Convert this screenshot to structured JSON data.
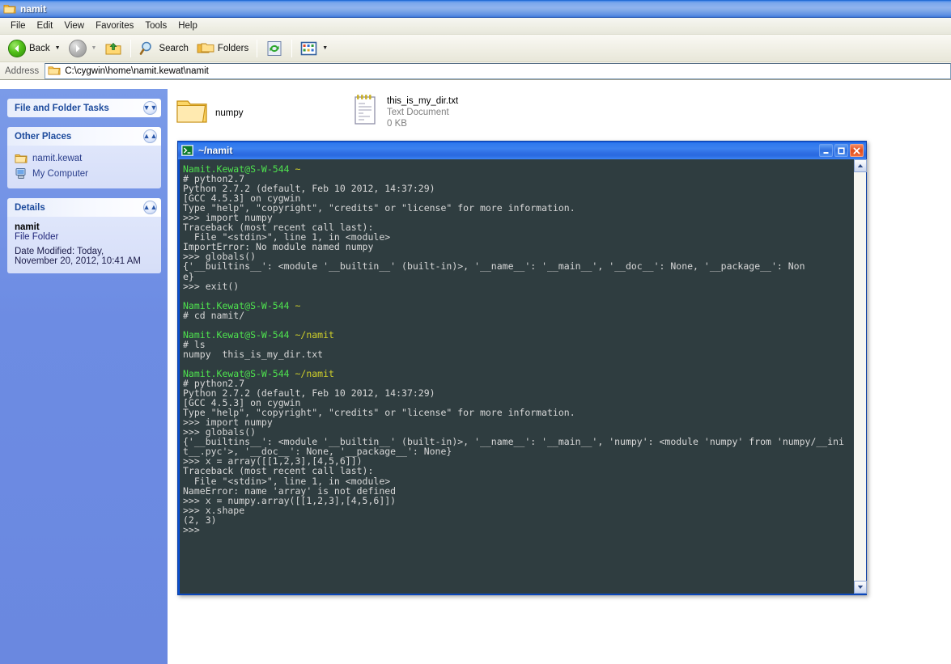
{
  "explorer": {
    "window_title": "namit",
    "window_icon": "folder-icon",
    "menu": [
      "File",
      "Edit",
      "View",
      "Favorites",
      "Tools",
      "Help"
    ],
    "toolbar": {
      "back_label": "Back",
      "back_icon": "back-arrow-icon",
      "forward_icon": "forward-arrow-icon",
      "up_icon": "up-folder-icon",
      "search_label": "Search",
      "search_icon": "search-icon",
      "folders_label": "Folders",
      "folders_icon": "folders-icon",
      "refresh_icon": "refresh-icon",
      "views_icon": "views-icon"
    },
    "address": {
      "label": "Address",
      "icon": "folder-icon",
      "value": "C:\\cygwin\\home\\namit.kewat\\namit",
      "placeholder": ""
    },
    "task_pane": {
      "groups": [
        {
          "title": "File and Folder Tasks",
          "chevron": "chevron-down-icon",
          "collapsed": true,
          "links": []
        },
        {
          "title": "Other Places",
          "chevron": "chevron-up-icon",
          "collapsed": false,
          "links": [
            {
              "label": "namit.kewat",
              "icon": "folder-icon"
            },
            {
              "label": "My Computer",
              "icon": "my-computer-icon"
            }
          ]
        },
        {
          "title": "Details",
          "chevron": "chevron-up-icon",
          "collapsed": false,
          "details": {
            "name": "namit",
            "type": "File Folder",
            "modified_line1": "Date Modified: Today,",
            "modified_line2": "November 20, 2012, 10:41 AM"
          }
        }
      ]
    },
    "files": [
      {
        "name": "numpy",
        "type": "",
        "size": "",
        "icon": "folder-icon"
      },
      {
        "name": "this_is_my_dir.txt",
        "type": "Text Document",
        "size": "0 KB",
        "icon": "text-document-icon"
      }
    ]
  },
  "terminal": {
    "window_title": "~/namit",
    "window_icon": "console-icon",
    "buttons": {
      "minimize": "_",
      "maximize": "□",
      "close": "✕"
    },
    "colors": {
      "background": "#2f3d40",
      "text": "#d8d8d8",
      "prompt_host": "#4ee24e",
      "prompt_path": "#cfcf2a",
      "titlebar": "#2a6ae0"
    },
    "scrollbar": {
      "up_icon": "chevron-up-icon",
      "down_icon": "chevron-down-icon"
    },
    "lines": [
      {
        "segments": [
          {
            "text": "Namit.Kewat@S-W-544 ",
            "color": "green"
          },
          {
            "text": "~",
            "color": "yellow"
          }
        ]
      },
      {
        "segments": [
          {
            "text": "# python2.7",
            "color": "white"
          }
        ]
      },
      {
        "segments": [
          {
            "text": "Python 2.7.2 (default, Feb 10 2012, 14:37:29)",
            "color": "white"
          }
        ]
      },
      {
        "segments": [
          {
            "text": "[GCC 4.5.3] on cygwin",
            "color": "white"
          }
        ]
      },
      {
        "segments": [
          {
            "text": "Type \"help\", \"copyright\", \"credits\" or \"license\" for more information.",
            "color": "white"
          }
        ]
      },
      {
        "segments": [
          {
            "text": ">>> import numpy",
            "color": "white"
          }
        ]
      },
      {
        "segments": [
          {
            "text": "Traceback (most recent call last):",
            "color": "white"
          }
        ]
      },
      {
        "segments": [
          {
            "text": "  File \"<stdin>\", line 1, in <module>",
            "color": "white"
          }
        ]
      },
      {
        "segments": [
          {
            "text": "ImportError: No module named numpy",
            "color": "white"
          }
        ]
      },
      {
        "segments": [
          {
            "text": ">>> globals()",
            "color": "white"
          }
        ]
      },
      {
        "segments": [
          {
            "text": "{'__builtins__': <module '__builtin__' (built-in)>, '__name__': '__main__', '__doc__': None, '__package__': Non",
            "color": "white"
          }
        ]
      },
      {
        "segments": [
          {
            "text": "e}",
            "color": "white"
          }
        ]
      },
      {
        "segments": [
          {
            "text": ">>> exit()",
            "color": "white"
          }
        ]
      },
      {
        "segments": [
          {
            "text": "",
            "color": "white"
          }
        ]
      },
      {
        "segments": [
          {
            "text": "Namit.Kewat@S-W-544 ",
            "color": "green"
          },
          {
            "text": "~",
            "color": "yellow"
          }
        ]
      },
      {
        "segments": [
          {
            "text": "# cd namit/",
            "color": "white"
          }
        ]
      },
      {
        "segments": [
          {
            "text": "",
            "color": "white"
          }
        ]
      },
      {
        "segments": [
          {
            "text": "Namit.Kewat@S-W-544 ",
            "color": "green"
          },
          {
            "text": "~/namit",
            "color": "yellow"
          }
        ]
      },
      {
        "segments": [
          {
            "text": "# ls",
            "color": "white"
          }
        ]
      },
      {
        "segments": [
          {
            "text": "numpy  this_is_my_dir.txt",
            "color": "white"
          }
        ]
      },
      {
        "segments": [
          {
            "text": "",
            "color": "white"
          }
        ]
      },
      {
        "segments": [
          {
            "text": "Namit.Kewat@S-W-544 ",
            "color": "green"
          },
          {
            "text": "~/namit",
            "color": "yellow"
          }
        ]
      },
      {
        "segments": [
          {
            "text": "# python2.7",
            "color": "white"
          }
        ]
      },
      {
        "segments": [
          {
            "text": "Python 2.7.2 (default, Feb 10 2012, 14:37:29)",
            "color": "white"
          }
        ]
      },
      {
        "segments": [
          {
            "text": "[GCC 4.5.3] on cygwin",
            "color": "white"
          }
        ]
      },
      {
        "segments": [
          {
            "text": "Type \"help\", \"copyright\", \"credits\" or \"license\" for more information.",
            "color": "white"
          }
        ]
      },
      {
        "segments": [
          {
            "text": ">>> import numpy",
            "color": "white"
          }
        ]
      },
      {
        "segments": [
          {
            "text": ">>> globals()",
            "color": "white"
          }
        ]
      },
      {
        "segments": [
          {
            "text": "{'__builtins__': <module '__builtin__' (built-in)>, '__name__': '__main__', 'numpy': <module 'numpy' from 'numpy/__ini",
            "color": "white"
          }
        ]
      },
      {
        "segments": [
          {
            "text": "t__.pyc'>, '__doc__': None, '__package__': None}",
            "color": "white"
          }
        ]
      },
      {
        "segments": [
          {
            "text": ">>> x = array([[1,2,3],[4,5,6]])",
            "color": "white"
          }
        ]
      },
      {
        "segments": [
          {
            "text": "Traceback (most recent call last):",
            "color": "white"
          }
        ]
      },
      {
        "segments": [
          {
            "text": "  File \"<stdin>\", line 1, in <module>",
            "color": "white"
          }
        ]
      },
      {
        "segments": [
          {
            "text": "NameError: name 'array' is not defined",
            "color": "white"
          }
        ]
      },
      {
        "segments": [
          {
            "text": ">>> x = numpy.array([[1,2,3],[4,5,6]])",
            "color": "white"
          }
        ]
      },
      {
        "segments": [
          {
            "text": ">>> x.shape",
            "color": "white"
          }
        ]
      },
      {
        "segments": [
          {
            "text": "(2, 3)",
            "color": "white"
          }
        ]
      },
      {
        "segments": [
          {
            "text": ">>>",
            "color": "white"
          }
        ]
      }
    ]
  }
}
